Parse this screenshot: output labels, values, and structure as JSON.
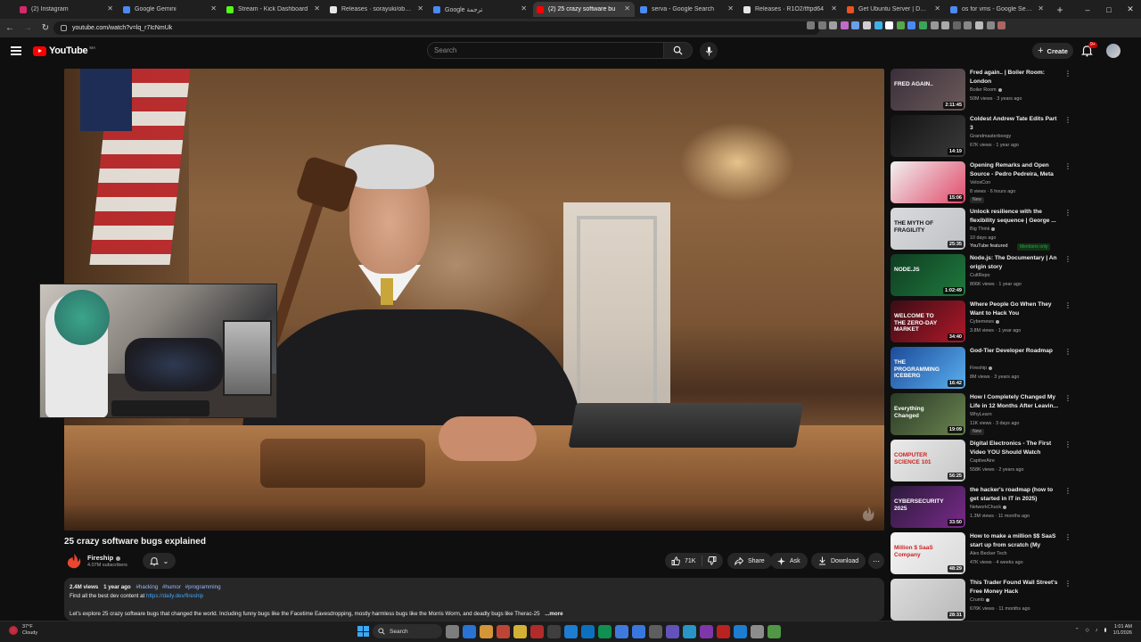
{
  "browser": {
    "tabs": [
      {
        "title": "(2) Instagram",
        "color": "#d6286b"
      },
      {
        "title": "Google Gemini",
        "color": "#4a8af4"
      },
      {
        "title": "Stream - Kick Dashboard",
        "color": "#53fc18"
      },
      {
        "title": "Releases · sorayuki/obs-multi",
        "color": "#e6e6e6"
      },
      {
        "title": "Google ترجمة",
        "color": "#4a8af4"
      },
      {
        "title": "(2) 25 crazy software bu",
        "color": "#ff0000",
        "active": true
      },
      {
        "title": "serva - Google Search",
        "color": "#4a8af4"
      },
      {
        "title": "Releases · R1O2/tftpd64",
        "color": "#e6e6e6"
      },
      {
        "title": "Get Ubuntu Server | Downlo",
        "color": "#e95420"
      },
      {
        "title": "os for vms - Google Search",
        "color": "#4a8af4"
      }
    ],
    "url": "youtube.com/watch?v=lq_r7IcNmUk"
  },
  "masthead": {
    "logo_text": "YouTube",
    "country_code": "MA",
    "search_placeholder": "Search",
    "create_label": "Create",
    "notif_badge": "9+"
  },
  "video": {
    "title": "25 crazy software bugs explained",
    "channel": "Fireship",
    "subscribers": "4.07M subscribers",
    "likes": "71K",
    "share_label": "Share",
    "ask_label": "Ask",
    "download_label": "Download"
  },
  "description": {
    "views": "2.4M views",
    "age": "1 year ago",
    "tags": [
      "#hacking",
      "#humor",
      "#programming"
    ],
    "line2_prefix": "Find all the best dev content at",
    "line2_link": "https://daily.dev/fireship",
    "line3": "Let's explore 25 crazy software bugs that changed the world. Including funny bugs like the Facetime Eavesdropping, mostly harmless bugs like the Morris Worm, and deadly bugs like Therac-25",
    "more_label": "...more"
  },
  "recommendations": [
    {
      "title": "Fred again.. | Boiler Room: London",
      "channel": "Boiler Room",
      "verified": true,
      "meta": "50M views · 3 years ago",
      "duration": "2:11:45",
      "thumb": "#3a2f3a",
      "thumb2": "#6b5a5a",
      "thumb_text": "FRED AGAIN..",
      "thumb_text_color": "#ffffff"
    },
    {
      "title": "Coldest Andrew Tate Edits Part 3",
      "channel": "Grandmasterboogy",
      "verified": false,
      "meta": "67K views · 1 year ago",
      "duration": "14:19",
      "thumb": "#141414",
      "thumb2": "#3a3a3a",
      "thumb_text": "",
      "thumb_text_color": "#ffffff"
    },
    {
      "title": "Opening Remarks and Open Source - Pedro Pedreira, Meta",
      "channel": "VeloxCon",
      "verified": false,
      "meta": "8 views · 6 hours ago",
      "badge": "New",
      "duration": "15:06",
      "thumb": "#f1f1f1",
      "thumb2": "#e04a6a",
      "thumb_text": "",
      "thumb_text_color": "#222222"
    },
    {
      "title": "Unlock resilience with the flexibility sequence | George ...",
      "channel": "Big Think",
      "verified": true,
      "meta": "10 days ago",
      "extra": "YouTube featured",
      "members": "Members only",
      "duration": "25:35",
      "thumb": "#d9dadc",
      "thumb2": "#bfc2c6",
      "thumb_text": "THE MYTH OF FRAGILITY",
      "thumb_text_color": "#111111"
    },
    {
      "title": "Node.js: The Documentary | An origin story",
      "channel": "CultRepo",
      "verified": false,
      "meta": "806K views · 1 year ago",
      "duration": "1:02:49",
      "thumb": "#0f3d22",
      "thumb2": "#1f7a3d",
      "thumb_text": "NODE.JS",
      "thumb_text_color": "#ffffff"
    },
    {
      "title": "Where People Go When They Want to Hack You",
      "channel": "Cybernews",
      "verified": true,
      "meta": "3.8M views · 1 year ago",
      "duration": "34:40",
      "thumb": "#3a0d14",
      "thumb2": "#b0182a",
      "thumb_text": "WELCOME TO THE ZERO-DAY MARKET",
      "thumb_text_color": "#ffffff"
    },
    {
      "title": "God-Tier Developer Roadmap",
      "channel": "Fireship",
      "verified": true,
      "meta": "8M views · 3 years ago",
      "duration": "16:42",
      "thumb": "#1c4a9a",
      "thumb2": "#5ab0ef",
      "thumb_text": "THE PROGRAMMING ICEBERG",
      "thumb_text_color": "#ffffff"
    },
    {
      "title": "How I Completely Changed My Life in 12 Months After Leavin...",
      "channel": "WhyLearn",
      "verified": false,
      "meta": "11K views · 3 days ago",
      "badge": "New",
      "duration": "19:09",
      "thumb": "#2a3a26",
      "thumb2": "#6a8450",
      "thumb_text": "Everything Changed",
      "thumb_text_color": "#ffffff"
    },
    {
      "title": "Digital Electronics - The First Video YOU Should Watch",
      "channel": "CaptiveAire",
      "verified": false,
      "meta": "558K views · 2 years ago",
      "duration": "56:25",
      "thumb": "#eaeaea",
      "thumb2": "#c7c7c7",
      "thumb_text": "COMPUTER SCIENCE 101",
      "thumb_text_color": "#cc2222"
    },
    {
      "title": "the hacker's roadmap (how to get started in IT in 2025)",
      "channel": "NetworkChuck",
      "verified": true,
      "meta": "1.3M views · 11 months ago",
      "duration": "33:50",
      "thumb": "#2a1a3a",
      "thumb2": "#7a2a8a",
      "thumb_text": "CYBERSECURITY 2025",
      "thumb_text_color": "#ffffff"
    },
    {
      "title": "How to make a million $$ SaaS start up from scratch (My entir...",
      "channel": "Alex Becker Tech",
      "verified": false,
      "meta": "47K views · 4 weeks ago",
      "duration": "48:29",
      "thumb": "#f4f4f4",
      "thumb2": "#d9d9d9",
      "thumb_text": "Million $ SaaS Company",
      "thumb_text_color": "#cc2222"
    },
    {
      "title": "This Trader Found Wall Street's Free Money Hack",
      "channel": "Crumb",
      "verified": true,
      "meta": "676K views · 11 months ago",
      "duration": "28:31",
      "thumb": "#dcdcdc",
      "thumb2": "#b9b9b9",
      "thumb_text": "",
      "thumb_text_color": "#111111"
    }
  ],
  "taskbar": {
    "weather_temp": "37°F",
    "weather_desc": "Cloudy",
    "search_label": "Search",
    "time": "1:01 AM",
    "date": "1/1/2026",
    "icon_colors": [
      "#888888",
      "#2b7de9",
      "#e8a33a",
      "#d04a3a",
      "#e8c23a",
      "#c22d2d",
      "#444444",
      "#1e88e5",
      "#0b7ad1",
      "#0f9d58",
      "#4285f4",
      "#3c82f6",
      "#666666",
      "#6a5acd",
      "#2aa3d9",
      "#8a3ab9",
      "#cc2222",
      "#1e88e5",
      "#999999",
      "#57a64a"
    ]
  }
}
